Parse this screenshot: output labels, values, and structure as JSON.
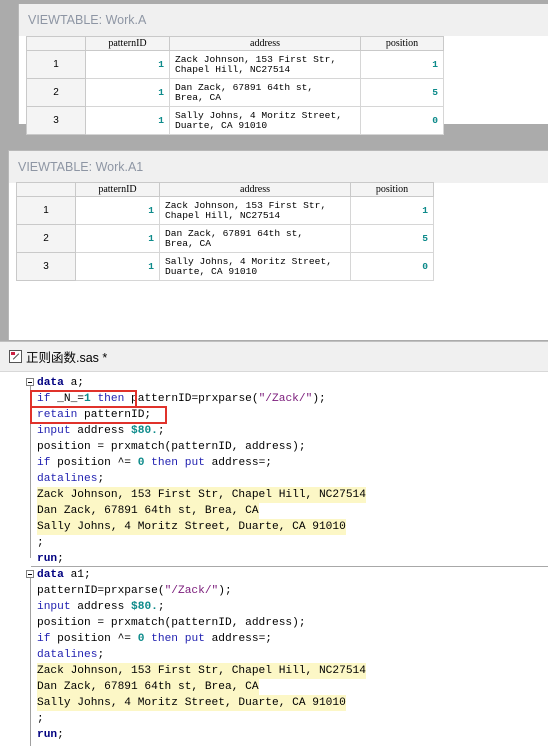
{
  "viewtable_a": {
    "title": "VIEWTABLE: Work.A",
    "columns": [
      "",
      "patternID",
      "address",
      "position"
    ],
    "rows": [
      {
        "n": "1",
        "patternID": "1",
        "address": "Zack Johnson, 153 First Str,\nChapel Hill, NC27514",
        "position": "1"
      },
      {
        "n": "2",
        "patternID": "1",
        "address": "Dan Zack, 67891 64th st,\nBrea, CA",
        "position": "5"
      },
      {
        "n": "3",
        "patternID": "1",
        "address": "Sally Johns, 4 Moritz Street,\nDuarte, CA 91010",
        "position": "0"
      }
    ]
  },
  "viewtable_a1": {
    "title": "VIEWTABLE: Work.A1",
    "columns": [
      "",
      "patternID",
      "address",
      "position"
    ],
    "rows": [
      {
        "n": "1",
        "patternID": "1",
        "address": "Zack Johnson, 153 First Str,\nChapel Hill, NC27514",
        "position": "1"
      },
      {
        "n": "2",
        "patternID": "1",
        "address": "Dan Zack, 67891 64th st,\nBrea, CA",
        "position": "5"
      },
      {
        "n": "3",
        "patternID": "1",
        "address": "Sally Johns, 4 Moritz Street,\nDuarte, CA 91010",
        "position": "0"
      }
    ]
  },
  "editor": {
    "title": "正则函数.sas *",
    "step1": {
      "data_kw": "data",
      "data_name": " a;",
      "l1_if": "if",
      "l1_var": " _N_=",
      "l1_num": "1",
      "l1_then": "then",
      "l1_rest": "patternID=prxparse(",
      "l1_str": "\"/Zack/\"",
      "l1_end": ");",
      "l2_kw": "retain",
      "l2_rest": " patternID;",
      "l3_kw": "input",
      "l3_rest": " address ",
      "l3_fmt": "$80.",
      "l3_end": ";",
      "l4": "position = prxmatch(patternID, address);",
      "l5_if": "if",
      "l5_var": " position ^= ",
      "l5_num": "0",
      "l5_then": " then",
      "l5_put": " put",
      "l5_end": " address=;",
      "l6_kw": "datalines",
      "lines": [
        "Zack Johnson, 153 First Str, Chapel Hill, NC27514",
        "Dan Zack, 67891 64th st, Brea, CA",
        "Sally Johns, 4 Moritz Street, Duarte, CA 91010"
      ],
      "semi": ";",
      "run": "run"
    },
    "step2": {
      "data_kw": "data",
      "data_name": " a1;",
      "l1_rest": "patternID=prxparse(",
      "l1_str": "\"/Zack/\"",
      "l1_end": ");",
      "l3_kw": "input",
      "l3_rest": " address ",
      "l3_fmt": "$80.",
      "l3_end": ";",
      "l4": "position = prxmatch(patternID, address);",
      "l5_if": "if",
      "l5_var": " position ^= ",
      "l5_num": "0",
      "l5_then": " then",
      "l5_put": " put",
      "l5_end": " address=;",
      "l6_kw": "datalines",
      "lines": [
        "Zack Johnson, 153 First Str, Chapel Hill, NC27514",
        "Dan Zack, 67891 64th st, Brea, CA",
        "Sally Johns, 4 Moritz Street, Duarte, CA 91010"
      ],
      "semi": ";",
      "run": "run"
    }
  },
  "colors": {
    "highlight_box": "#e0322b",
    "keyword": "#1f1fb0",
    "datalines_bg": "#fcf7c6"
  }
}
